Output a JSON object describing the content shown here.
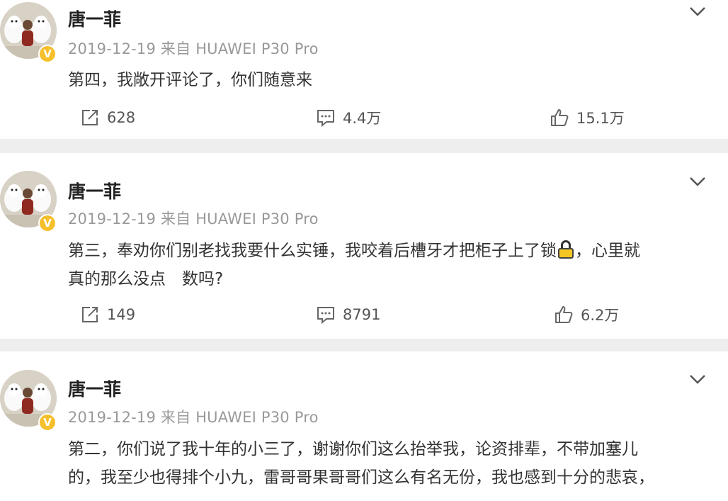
{
  "posts": [
    {
      "name": "唐一菲",
      "meta": "2019-12-19 来自 HUAWEI P30 Pro",
      "text_lines": [
        "第四，我敞开评论了，你们随意来"
      ],
      "repost": "628",
      "comment": "4.4万",
      "like": "15.1万"
    },
    {
      "name": "唐一菲",
      "meta": "2019-12-19 来自 HUAWEI P30 Pro",
      "text_lines": [
        "第三，奉劝你们别老找我要什么实锤，我咬着后槽牙才把柜子上了锁",
        "，心里就",
        "真的那么没点　数吗?"
      ],
      "repost": "149",
      "comment": "8791",
      "like": "6.2万"
    },
    {
      "name": "唐一菲",
      "meta": "2019-12-19 来自 HUAWEI P30 Pro",
      "text_lines": [
        "第二，你们说了我十年的小三了，谢谢你们这么抬举我，论资排辈，不带加塞儿",
        "的，我至少也得排个小九，雷哥哥果哥哥们这么有名无份，我也感到十分的悲哀，"
      ]
    }
  ],
  "icons": {
    "avatar": "avatar-with-dogs",
    "badge": "verified-v-badge",
    "more": "chevron-down-icon",
    "repost": "repost-icon",
    "comment": "comment-icon",
    "like": "thumbs-up-icon"
  },
  "colors": {
    "badge": "#f5c02b",
    "divider": "#eeeeee",
    "meta": "#999999"
  }
}
